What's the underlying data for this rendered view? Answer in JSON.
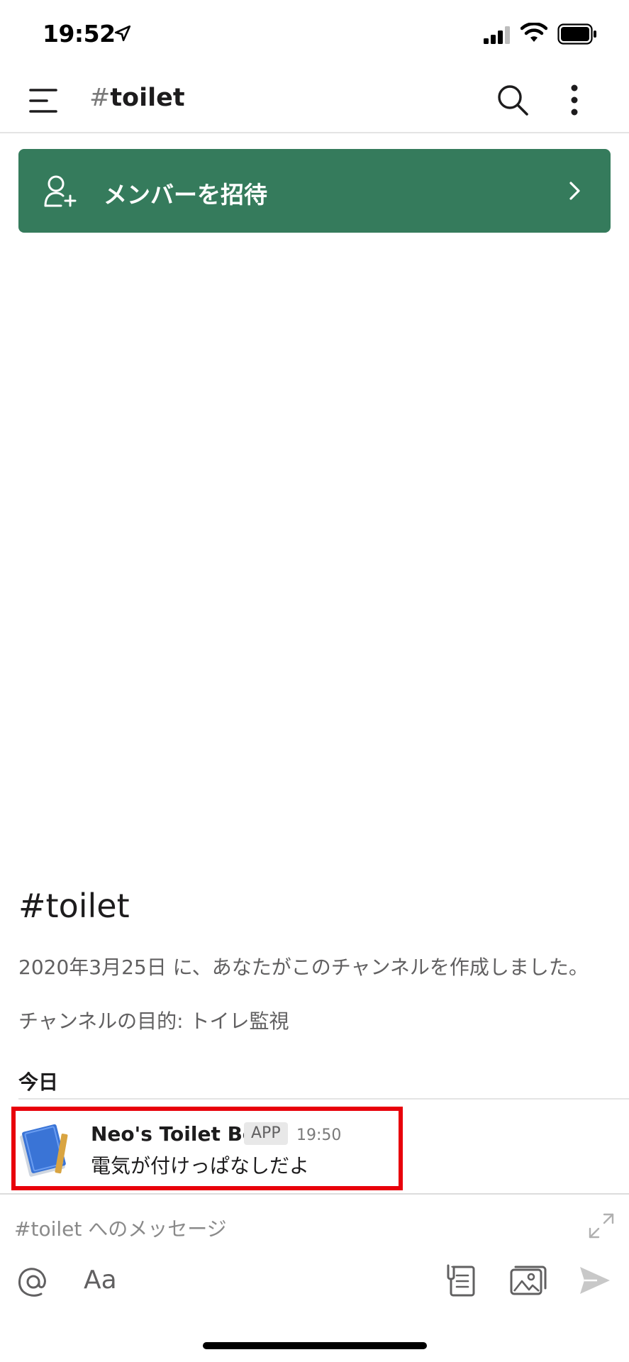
{
  "status_bar": {
    "time": "19:52",
    "icons": [
      "location-arrow-icon",
      "signal-icon",
      "wifi-icon",
      "battery-icon"
    ]
  },
  "header": {
    "hash": "#",
    "channel_name": "toilet",
    "icons": [
      "menu-icon",
      "search-icon",
      "more-vertical-icon"
    ]
  },
  "invite_banner": {
    "label": "メンバーを招待",
    "color": "#357b5c",
    "icons": [
      "add-user-icon",
      "chevron-right-icon"
    ]
  },
  "channel_intro": {
    "title": "#toilet",
    "created_text": "2020年3月25日 に、あなたがこのチャンネルを作成しました。",
    "purpose_text": "チャンネルの目的: トイレ監視"
  },
  "day_divider": "今日",
  "messages": [
    {
      "sender": "Neo's Toilet Bot",
      "badge": "APP",
      "time": "19:50",
      "text": "電気が付けっぱなしだよ",
      "avatar_icon": "notebook-icon",
      "highlight_color": "#e8000b"
    }
  ],
  "composer": {
    "placeholder": "#toilet へのメッセージ",
    "format_label": "Aa",
    "icons": [
      "expand-icon",
      "at-icon",
      "file-icon",
      "photo-icon",
      "send-icon"
    ]
  }
}
